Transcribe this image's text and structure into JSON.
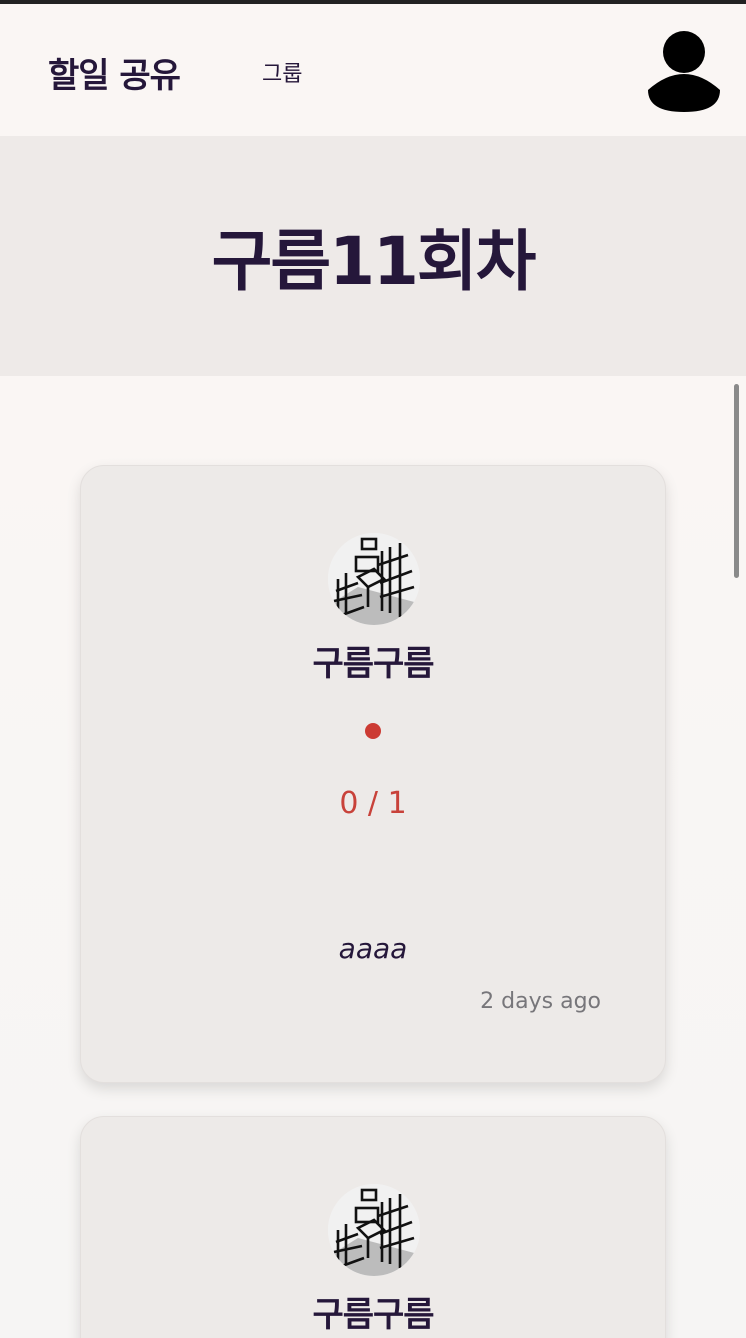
{
  "header": {
    "brand": "할일 공유",
    "nav_group": "그룹",
    "profile_icon": "user-profile-icon"
  },
  "hero": {
    "title": "구름11회차"
  },
  "cards": [
    {
      "name": "구름구름",
      "status_color": "#cc3b33",
      "progress": "0 / 1",
      "todo": "aaaa",
      "time": "2 days ago"
    },
    {
      "name": "구름구름"
    }
  ]
}
